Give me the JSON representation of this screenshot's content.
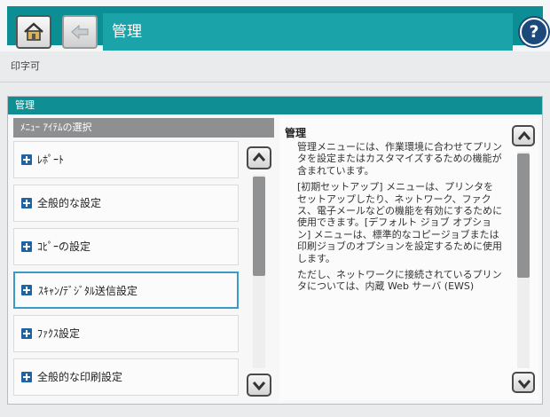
{
  "header": {
    "title": "管理",
    "help_label": "?"
  },
  "status": {
    "text": "印字可"
  },
  "panel": {
    "header": "管理",
    "list_header": "ﾒﾆｭｰ ｱｲﾃﾑの選択",
    "items": [
      {
        "label": "ﾚﾎﾟｰﾄ"
      },
      {
        "label": "全般的な設定"
      },
      {
        "label": "ｺﾋﾟｰの設定"
      },
      {
        "label": "ｽｷｬﾝ/ﾃﾞｼﾞﾀﾙ送信設定"
      },
      {
        "label": "ﾌｧｸｽ設定"
      },
      {
        "label": "全般的な印刷設定"
      }
    ],
    "selected_index": 3
  },
  "description": {
    "title": "管理",
    "paragraphs": [
      "管理メニューには、作業環境に合わせてプリンタを設定またはカスタマイズするための機能が含まれています。",
      "[初期セットアップ] メニューは、プリンタをセットアップしたり、ネットワーク、ファクス、電子メールなどの機能を有効にするために使用できます。[デフォルト ジョブ オプション] メニューは、標準的なコピージョブまたは印刷ジョブのオプションを設定するために使用します。",
      "ただし、ネットワークに接続されているプリンタについては、内蔵 Web サーバ (EWS)"
    ]
  },
  "icons": {
    "home": "home-icon",
    "back": "back-icon",
    "help": "help-icon",
    "plus": "plus-icon",
    "scroll_up": "chevron-up-icon",
    "scroll_down": "chevron-down-icon"
  },
  "colors": {
    "header_teal": "#0b8f95",
    "title_teal": "#1ba3aa",
    "help_blue": "#1b4a7a",
    "plus_blue": "#1f63a3",
    "selected_border": "#3c9bc4"
  }
}
